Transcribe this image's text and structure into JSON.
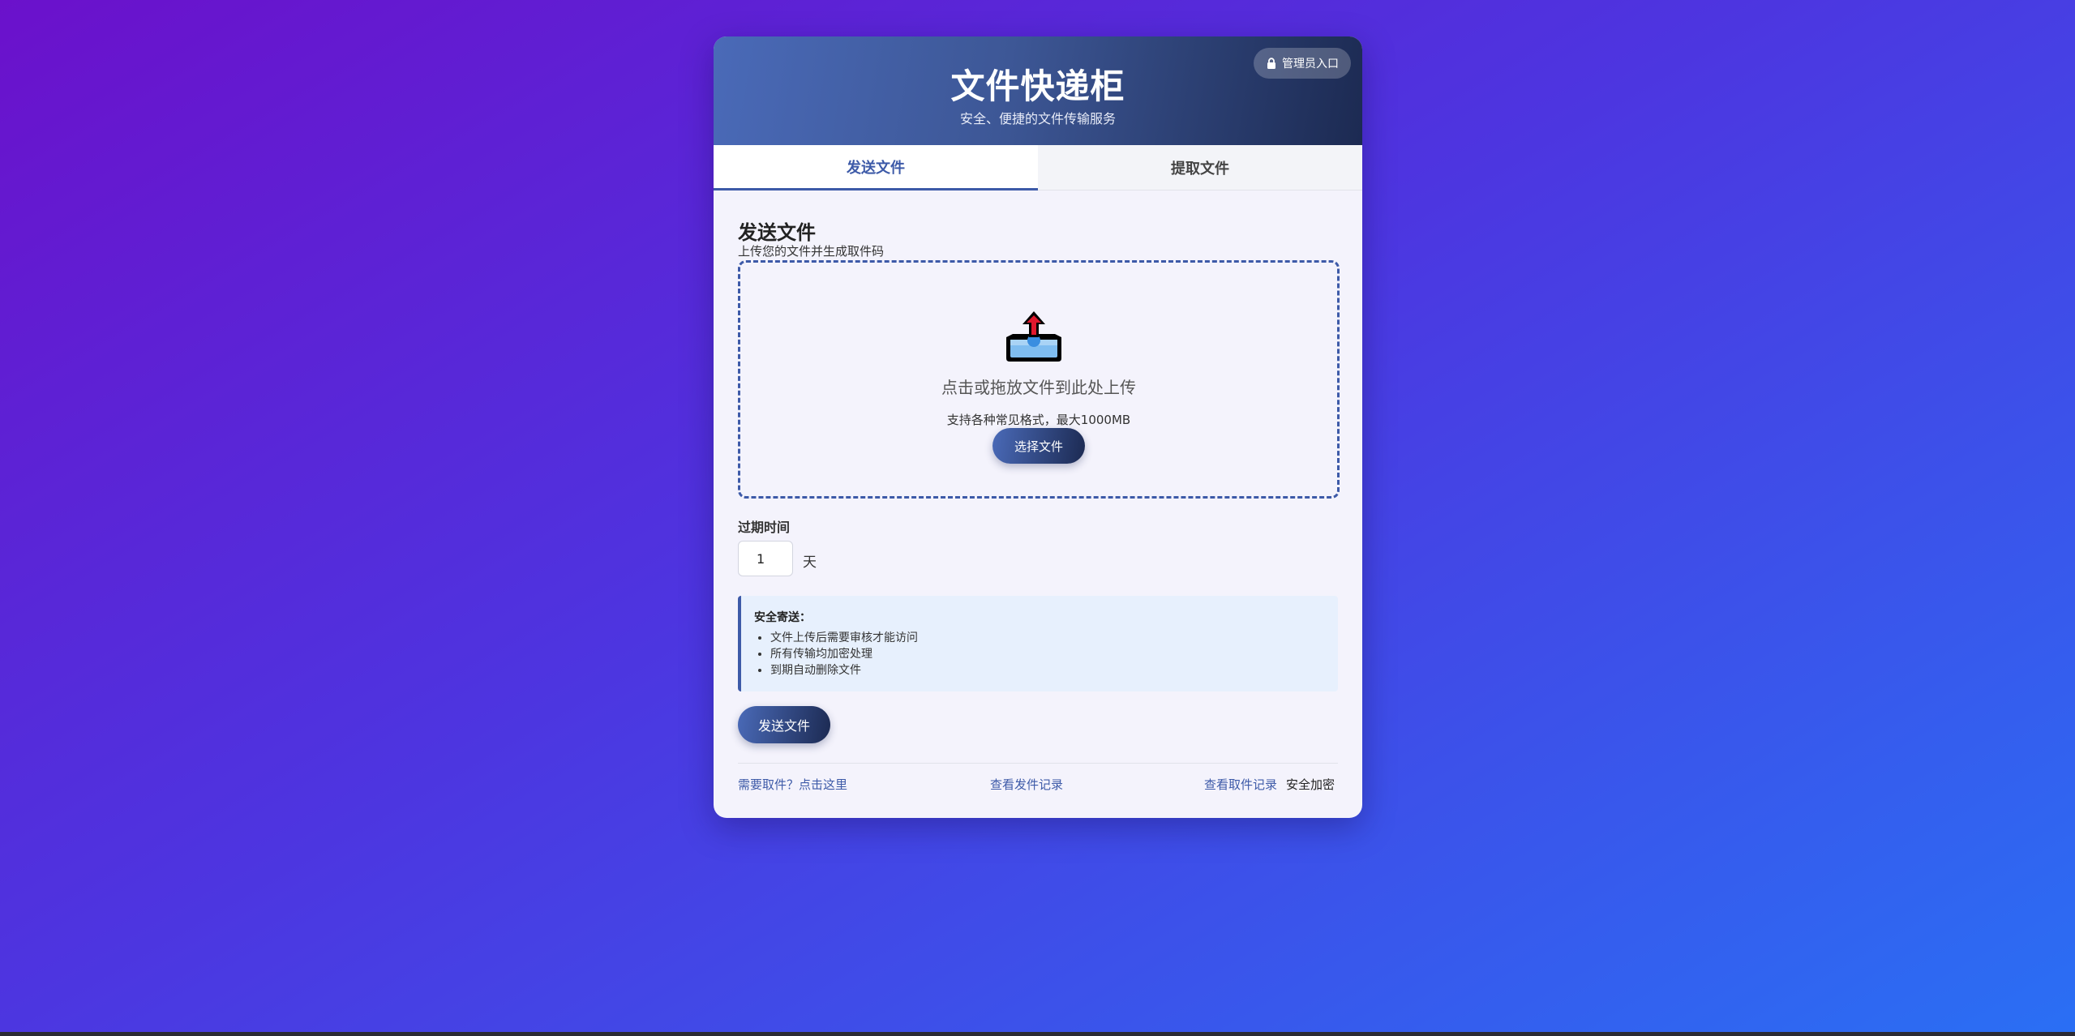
{
  "header": {
    "title": "文件快递柜",
    "subtitle": "安全、便捷的文件传输服务",
    "admin_label": "管理员入口"
  },
  "tabs": [
    {
      "label": "发送文件",
      "active": true
    },
    {
      "label": "提取文件",
      "active": false
    }
  ],
  "send": {
    "title": "发送文件",
    "subtitle": "上传您的文件并生成取件码",
    "dropzone_text": "点击或拖放文件到此处上传",
    "dropzone_hint": "支持各种常见格式，最大1000MB",
    "choose_button": "选择文件",
    "expire_label": "过期时间",
    "expire_value": "1",
    "expire_unit": "天",
    "info_title": "安全寄送：",
    "info_items": [
      "文件上传后需要审核才能访问",
      "所有传输均加密处理",
      "到期自动删除文件"
    ],
    "send_button": "发送文件"
  },
  "footer": {
    "pickup_link": "需要取件？点击这里",
    "send_records": "查看发件记录",
    "pickup_records": "查看取件记录",
    "secure_text": "安全加密"
  },
  "colors": {
    "accent": "#3d5aa8",
    "header_dark": "#1c2a52",
    "info_bg": "#e7f0fd"
  },
  "icons": {
    "admin": "lock-icon",
    "upload": "upload-tray-icon"
  }
}
